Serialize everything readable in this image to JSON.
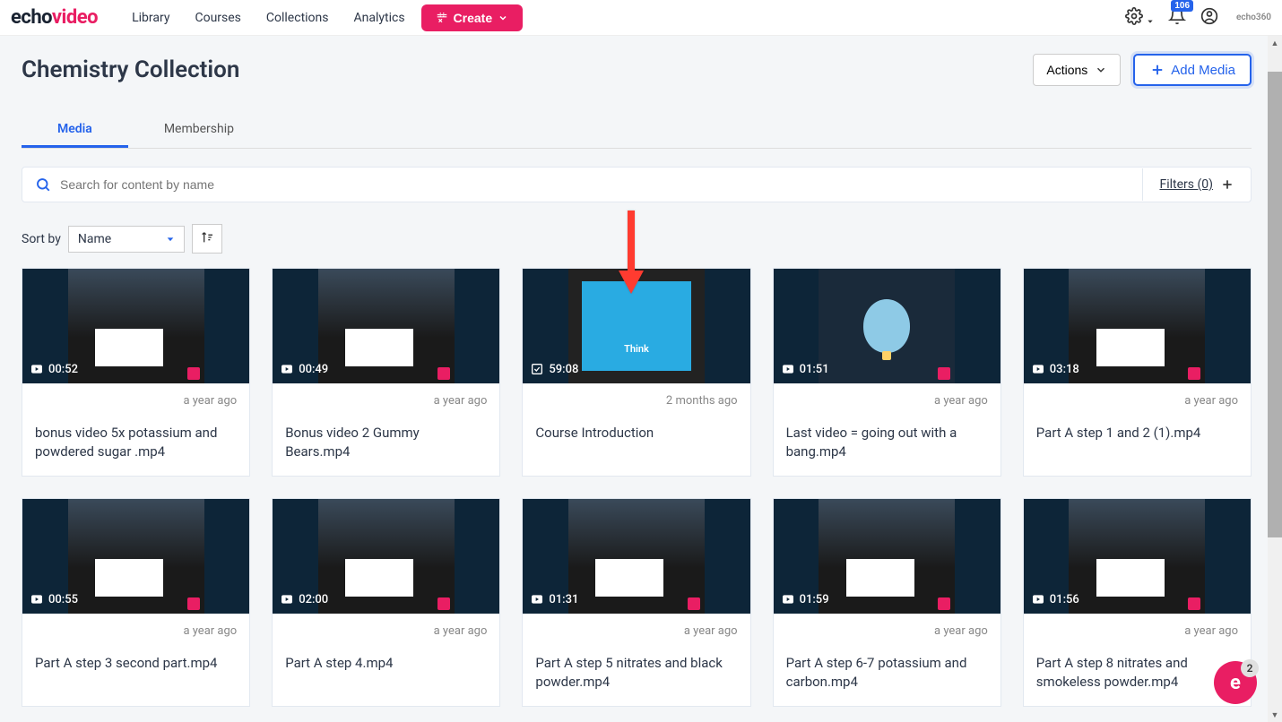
{
  "logo": {
    "part1": "echo",
    "part2": "video"
  },
  "nav": [
    "Library",
    "Courses",
    "Collections",
    "Analytics"
  ],
  "create_label": "Create",
  "notif_count": "106",
  "brand_small": "echo360",
  "page_title": "Chemistry Collection",
  "actions_label": "Actions",
  "add_media_label": "Add Media",
  "tabs": [
    {
      "label": "Media",
      "active": true
    },
    {
      "label": "Membership",
      "active": false
    }
  ],
  "search_placeholder": "Search for content by name",
  "filters_label": "Filters (0)",
  "sort_label": "Sort by",
  "sort_value": "Name",
  "videos": [
    {
      "duration": "00:52",
      "date": "a year ago",
      "title": "bonus video 5x potassium and powdered sugar .mp4",
      "thumb": "lab"
    },
    {
      "duration": "00:49",
      "date": "a year ago",
      "title": "Bonus video 2 Gummy Bears.mp4",
      "thumb": "lab"
    },
    {
      "duration": "59:08",
      "date": "2 months ago",
      "title": "Course Introduction",
      "thumb": "blue",
      "icon": "task"
    },
    {
      "duration": "01:51",
      "date": "a year ago",
      "title": "Last video = going out with a bang.mp4",
      "thumb": "balloon"
    },
    {
      "duration": "03:18",
      "date": "a year ago",
      "title": "Part A step 1 and 2 (1).mp4",
      "thumb": "lab"
    },
    {
      "duration": "00:55",
      "date": "a year ago",
      "title": "Part A step 3 second part.mp4",
      "thumb": "lab"
    },
    {
      "duration": "02:00",
      "date": "a year ago",
      "title": "Part A step 4.mp4",
      "thumb": "lab"
    },
    {
      "duration": "01:31",
      "date": "a year ago",
      "title": "Part A step 5 nitrates and black powder.mp4",
      "thumb": "lab"
    },
    {
      "duration": "01:59",
      "date": "a year ago",
      "title": "Part A step 6-7 potassium and carbon.mp4",
      "thumb": "lab"
    },
    {
      "duration": "01:56",
      "date": "a year ago",
      "title": "Part A step 8 nitrates and smokeless powder.mp4",
      "thumb": "lab"
    }
  ],
  "blue_text": "Think",
  "fab_badge": "2"
}
